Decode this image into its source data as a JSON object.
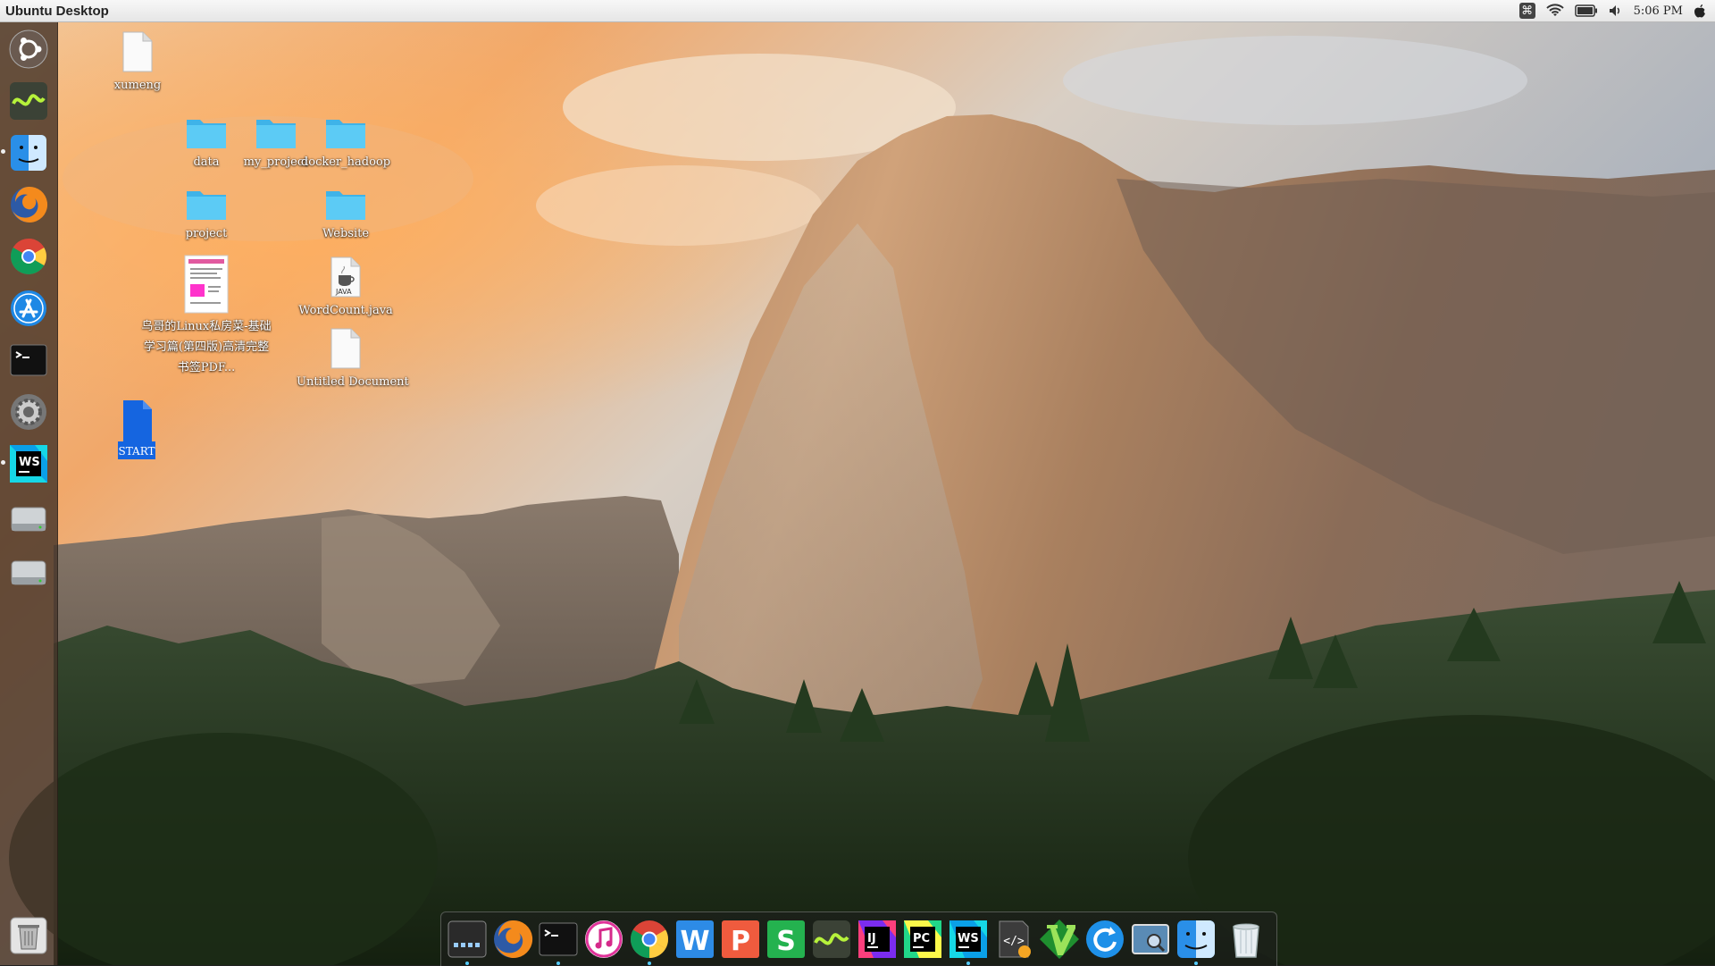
{
  "panel": {
    "title": "Ubuntu Desktop",
    "clock": "5:06 PM",
    "tray_icons": [
      "keyboard-icon",
      "wifi-icon",
      "battery-icon",
      "volume-icon",
      "apple-icon"
    ],
    "keyboard_symbol": "⌘"
  },
  "launcher": {
    "items": [
      {
        "name": "ubuntu-logo-icon"
      },
      {
        "name": "system-monitor-icon"
      },
      {
        "name": "finder-icon"
      },
      {
        "name": "firefox-icon"
      },
      {
        "name": "chrome-icon"
      },
      {
        "name": "app-store-icon"
      },
      {
        "name": "terminal-icon"
      },
      {
        "name": "system-settings-icon"
      },
      {
        "name": "webstorm-icon",
        "label": "WS"
      },
      {
        "name": "disk-drive-icon"
      },
      {
        "name": "disk-drive-icon"
      },
      {
        "name": "trash-icon"
      }
    ]
  },
  "desktop": {
    "icons": [
      {
        "label": "xumeng",
        "kind": "file"
      },
      {
        "label": "data",
        "kind": "folder"
      },
      {
        "label": "my_project",
        "kind": "folder"
      },
      {
        "label": "docker_hadoop",
        "kind": "folder"
      },
      {
        "label": "project",
        "kind": "folder"
      },
      {
        "label": "Website",
        "kind": "folder"
      },
      {
        "label": "鸟哥的Linux私房菜-基础学习篇(第四版)高清完整书签PDF...",
        "kind": "pdf"
      },
      {
        "label": "WordCount.java",
        "kind": "java",
        "badge": "JAVA"
      },
      {
        "label": "Untitled Document",
        "kind": "file"
      },
      {
        "label": "START",
        "kind": "doc"
      }
    ]
  },
  "dock": {
    "items": [
      {
        "name": "launchpad-icon"
      },
      {
        "name": "firefox-icon"
      },
      {
        "name": "terminal-icon"
      },
      {
        "name": "itunes-icon"
      },
      {
        "name": "chrome-icon"
      },
      {
        "name": "wps-writer-icon",
        "label": "W"
      },
      {
        "name": "wps-presentation-icon",
        "label": "P"
      },
      {
        "name": "wps-spreadsheet-icon",
        "label": "S"
      },
      {
        "name": "system-monitor-icon"
      },
      {
        "name": "intellij-idea-icon",
        "label": "IJ"
      },
      {
        "name": "pycharm-icon",
        "label": "PC"
      },
      {
        "name": "webstorm-icon",
        "label": "WS"
      },
      {
        "name": "code-editor-icon",
        "label": "</>"
      },
      {
        "name": "vim-icon",
        "label": "V"
      },
      {
        "name": "update-icon"
      },
      {
        "name": "screenshot-icon"
      },
      {
        "name": "finder-icon"
      },
      {
        "name": "trash-icon"
      }
    ]
  },
  "colors": {
    "folder": "#4fc3f7",
    "launcher_bg": "#46342a",
    "panel_bg": "#efefef"
  }
}
